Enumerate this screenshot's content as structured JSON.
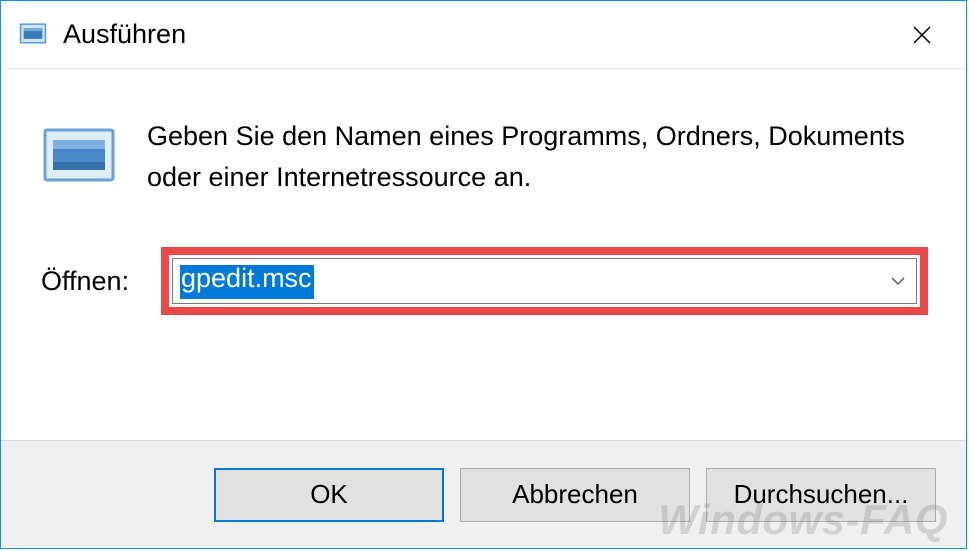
{
  "dialog": {
    "title": "Ausführen",
    "close_label": "✕",
    "info_text": "Geben Sie den Namen eines Programms, Ordners, Dokuments oder einer Internetressource an.",
    "open_label": "Öffnen:",
    "input_value": "gpedit.msc"
  },
  "buttons": {
    "ok": "OK",
    "cancel": "Abbrechen",
    "browse": "Durchsuchen..."
  },
  "watermark": "Windows-FAQ"
}
